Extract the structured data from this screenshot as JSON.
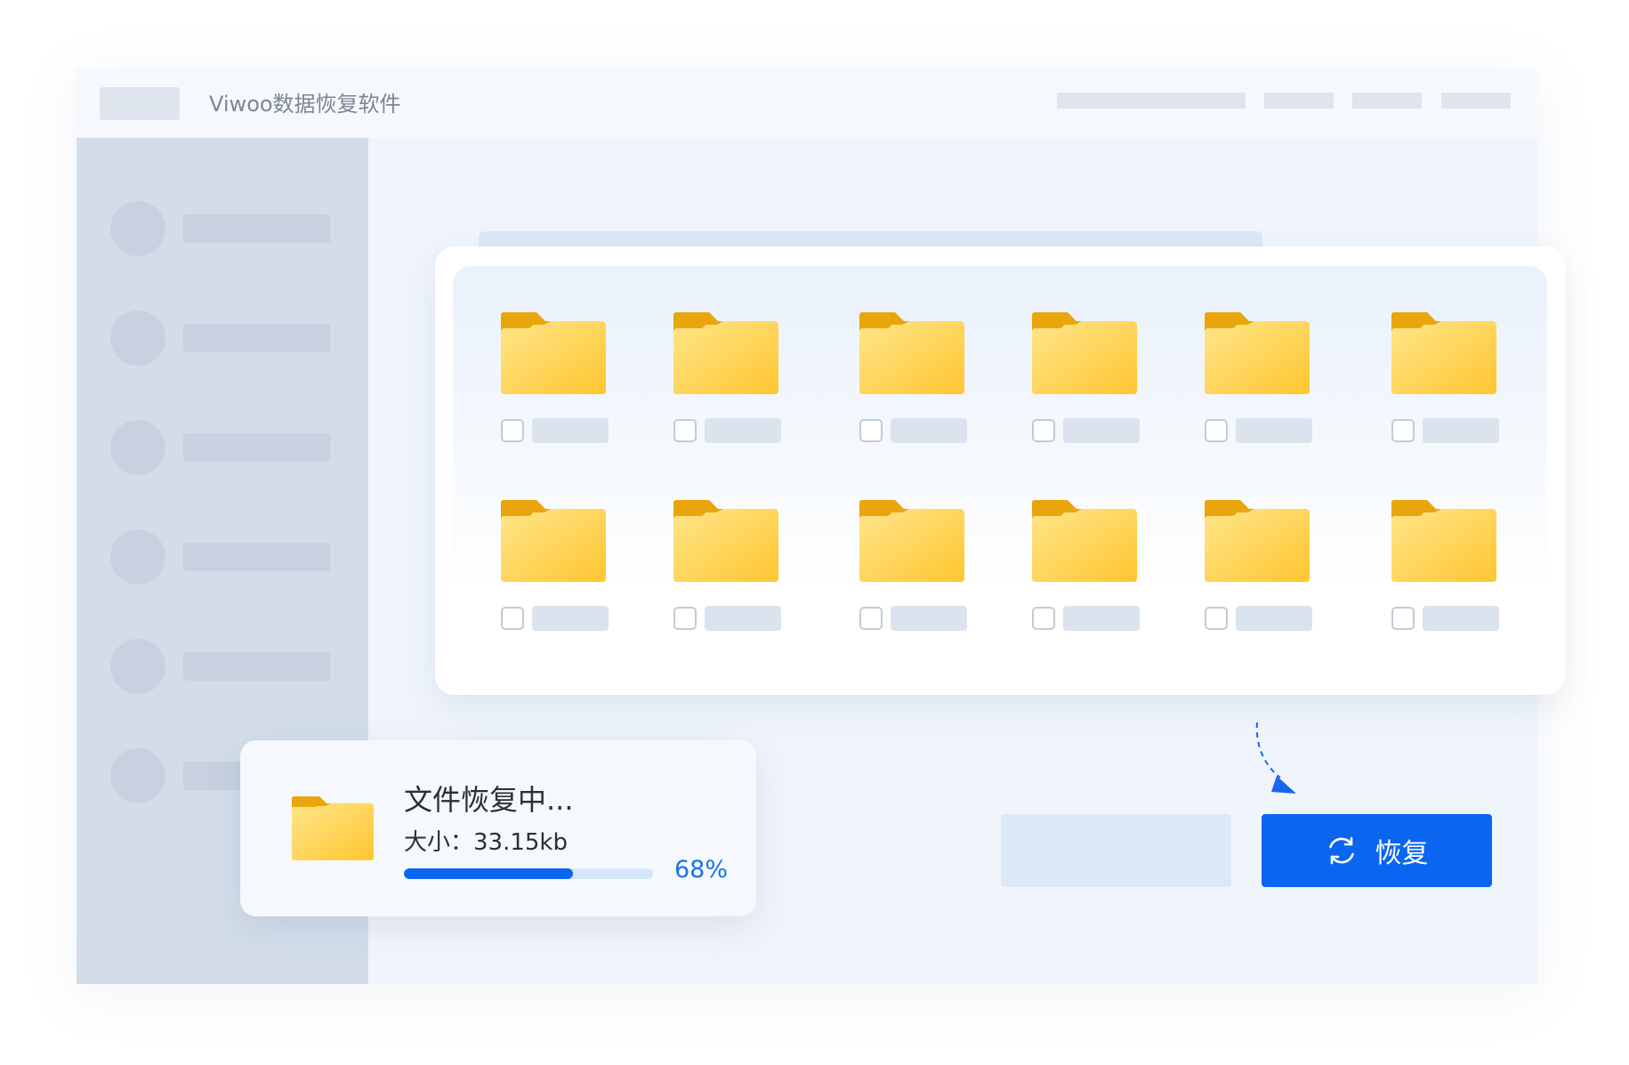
{
  "app": {
    "title": "Viwoo数据恢复软件"
  },
  "colors": {
    "accent": "#0a66f0",
    "folder_yellow": "#ffc93a",
    "sidebar": "#d3ddea"
  },
  "folders": {
    "icon": "folder-icon",
    "rows": 2,
    "cols": 6
  },
  "actions": {
    "recover_label": "恢复",
    "recover_icon": "refresh-icon"
  },
  "progress": {
    "title": "文件恢复中...",
    "size_text": "大小：33.15kb",
    "percent_text": "68%",
    "percent": 68
  }
}
